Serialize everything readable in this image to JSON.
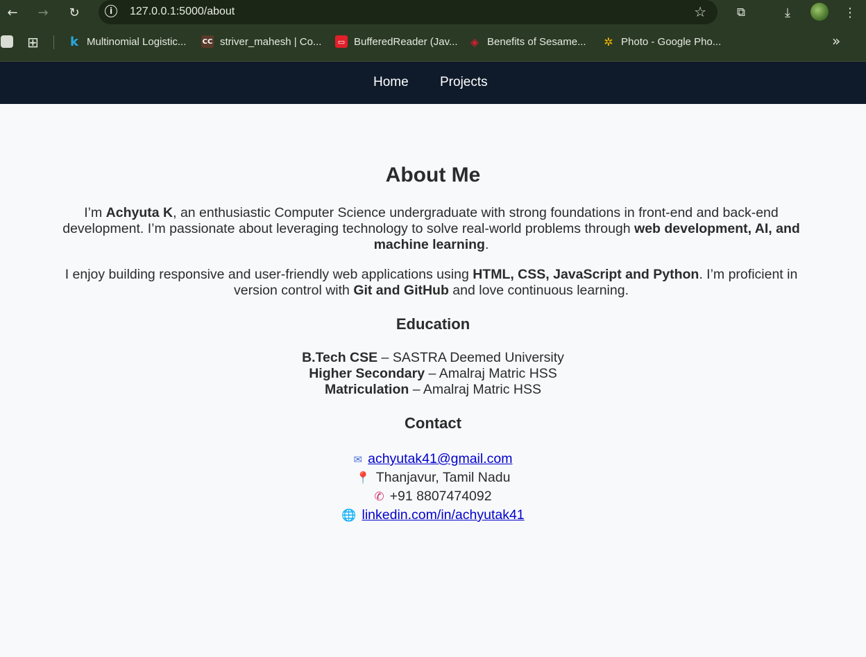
{
  "browser": {
    "url": "127.0.0.1:5000/about",
    "bookmarks": [
      "Multinomial Logistic...",
      "striver_mahesh | Co...",
      "BufferedReader (Jav...",
      "Benefits of Sesame...",
      "Photo - Google Pho..."
    ]
  },
  "nav": {
    "home": "Home",
    "projects": "Projects"
  },
  "about": {
    "title": "About Me",
    "p1": {
      "t1": "I’m ",
      "name": "Achyuta K",
      "t2": ", an enthusiastic Computer Science undergraduate with strong foundations in front-end and back-end development. I’m passionate about leveraging technology to solve real-world problems through ",
      "focus": "web development, AI, and machine learning",
      "t3": "."
    },
    "p2": {
      "t1": "I enjoy building responsive and user-friendly web applications using ",
      "skills": "HTML, CSS, JavaScript and Python",
      "t2": ". I’m proficient in version control with ",
      "vcs": "Git and GitHub",
      "t3": " and love continuous learning."
    }
  },
  "education": {
    "heading": "Education",
    "items": [
      {
        "degree": "B.Tech CSE",
        "sep": " – ",
        "school": "SASTRA Deemed University"
      },
      {
        "degree": "Higher Secondary",
        "sep": " – ",
        "school": "Amalraj Matric HSS"
      },
      {
        "degree": "Matriculation",
        "sep": " – ",
        "school": "Amalraj Matric HSS"
      }
    ]
  },
  "contact": {
    "heading": "Contact",
    "email": "achyutak41@gmail.com",
    "location": "Thanjavur, Tamil Nadu",
    "phone": "+91 8807474092",
    "linkedin": "linkedin.com/in/achyutak41",
    "icons": [
      "email-icon",
      "pin-icon",
      "phone-icon",
      "globe-icon"
    ]
  }
}
